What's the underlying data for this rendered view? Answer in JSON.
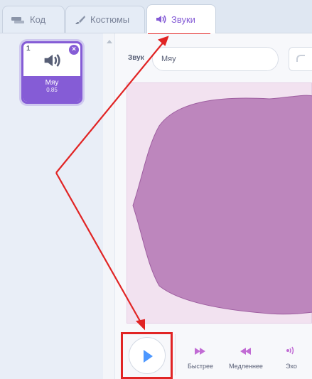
{
  "tabs": [
    {
      "label": "Код",
      "icon": "code-icon",
      "active": false
    },
    {
      "label": "Костюмы",
      "icon": "brush-icon",
      "active": false
    },
    {
      "label": "Звуки",
      "icon": "speaker-icon",
      "active": true
    }
  ],
  "sound_list": {
    "items": [
      {
        "index": "1",
        "name": "Мяу",
        "duration": "0.85",
        "icon": "speaker-icon"
      }
    ]
  },
  "editor": {
    "name_label": "Звук",
    "name_value": "Мяу"
  },
  "effects": [
    {
      "label": "Быстрее",
      "icon": "faster-icon"
    },
    {
      "label": "Медленнее",
      "icon": "slower-icon"
    },
    {
      "label": "Эхо",
      "icon": "echo-icon"
    }
  ],
  "colors": {
    "accent": "#855cd6",
    "waveform": "#bd86bd",
    "waveform_bg": "#f2e2f0",
    "play": "#4c97ff",
    "annotation": "#e12424"
  }
}
